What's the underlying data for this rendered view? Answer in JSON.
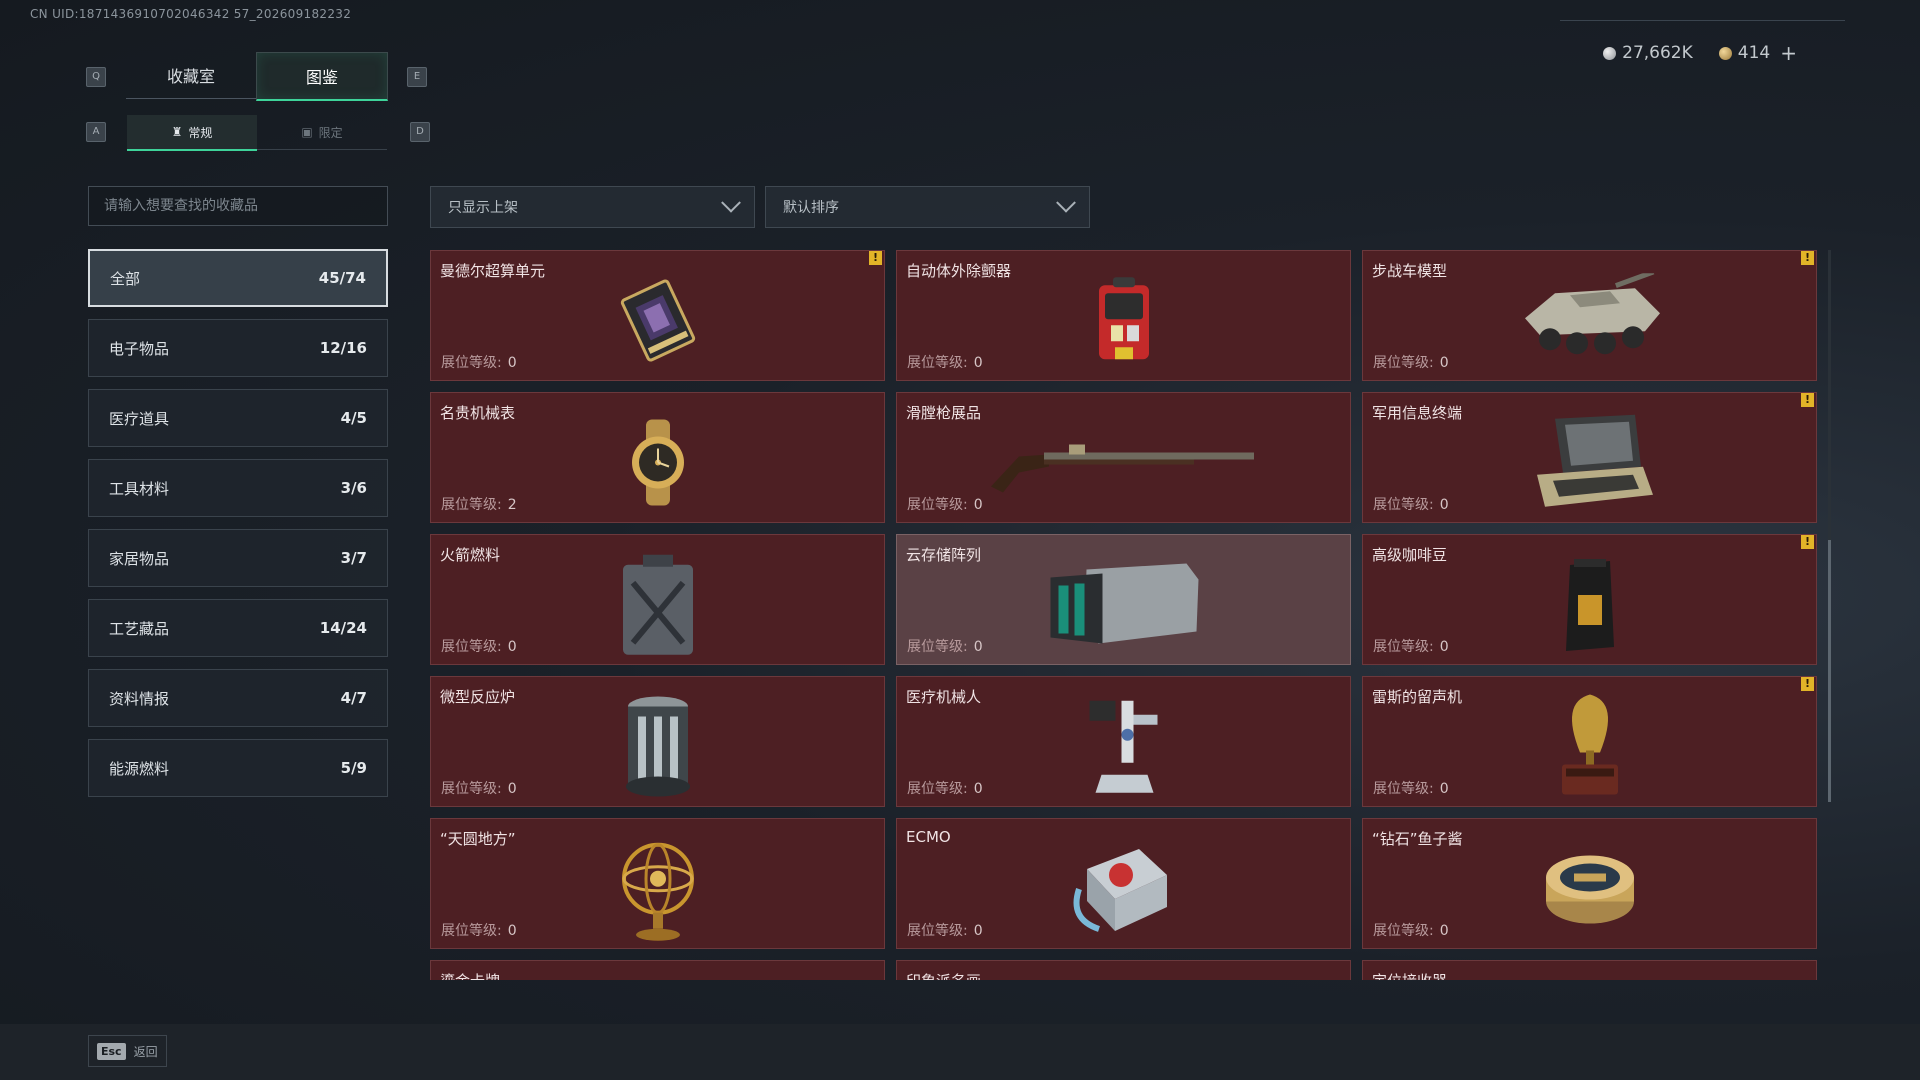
{
  "uid": "CN UID:1871436910702046342 57_202609182232",
  "currency": {
    "silver": "27,662K",
    "gold": "414",
    "plus": "+"
  },
  "keys": {
    "q": "Q",
    "e": "E",
    "a": "A",
    "d": "D"
  },
  "tabs": [
    {
      "label": "收藏室",
      "active": false
    },
    {
      "label": "图鉴",
      "active": true
    }
  ],
  "subtabs": [
    {
      "label": "常规",
      "active": true
    },
    {
      "label": "限定",
      "active": false
    }
  ],
  "search": {
    "placeholder": "请输入想要查找的收藏品"
  },
  "filters": {
    "shelf": "只显示上架",
    "sort": "默认排序"
  },
  "categories": [
    {
      "label": "全部",
      "count": "45/74"
    },
    {
      "label": "电子物品",
      "count": "12/16"
    },
    {
      "label": "医疗道具",
      "count": "4/5"
    },
    {
      "label": "工具材料",
      "count": "3/6"
    },
    {
      "label": "家居物品",
      "count": "3/7"
    },
    {
      "label": "工艺藏品",
      "count": "14/24"
    },
    {
      "label": "资料情报",
      "count": "4/7"
    },
    {
      "label": "能源燃料",
      "count": "5/9"
    }
  ],
  "level_label": "展位等级:",
  "items": [
    {
      "name": "曼德尔超算单元",
      "level": "0",
      "icon": "supercomputer-icon",
      "warn": true
    },
    {
      "name": "自动体外除颤器",
      "level": "0",
      "icon": "defibrillator-icon",
      "warn": false
    },
    {
      "name": "步战车模型",
      "level": "0",
      "icon": "ifv-model-icon",
      "warn": true
    },
    {
      "name": "名贵机械表",
      "level": "2",
      "icon": "watch-icon",
      "warn": false
    },
    {
      "name": "滑膛枪展品",
      "level": "0",
      "icon": "musket-icon",
      "warn": false
    },
    {
      "name": "军用信息终端",
      "level": "0",
      "icon": "terminal-icon",
      "warn": true
    },
    {
      "name": "火箭燃料",
      "level": "0",
      "icon": "fuel-can-icon",
      "warn": false
    },
    {
      "name": "云存储阵列",
      "level": "0",
      "icon": "storage-array-icon",
      "warn": false
    },
    {
      "name": "高级咖啡豆",
      "level": "0",
      "icon": "coffee-bag-icon",
      "warn": true
    },
    {
      "name": "微型反应炉",
      "level": "0",
      "icon": "reactor-icon",
      "warn": false
    },
    {
      "name": "医疗机械人",
      "level": "0",
      "icon": "medical-robot-icon",
      "warn": false
    },
    {
      "name": "雷斯的留声机",
      "level": "0",
      "icon": "gramophone-icon",
      "warn": true
    },
    {
      "name": "“天圆地方”",
      "level": "0",
      "icon": "armillary-icon",
      "warn": false
    },
    {
      "name": "ECMO",
      "level": "0",
      "icon": "ecmo-icon",
      "warn": false
    },
    {
      "name": "“钻石”鱼子酱",
      "level": "0",
      "icon": "caviar-tin-icon",
      "warn": false
    },
    {
      "name": "鎏金卡牌",
      "level": "",
      "icon": "card-icon",
      "warn": false
    },
    {
      "name": "印象派名画",
      "level": "",
      "icon": "painting-icon",
      "warn": false
    },
    {
      "name": "定位接收器",
      "level": "",
      "icon": "receiver-icon",
      "warn": false
    }
  ],
  "back": {
    "key": "Esc",
    "label": "返回"
  }
}
